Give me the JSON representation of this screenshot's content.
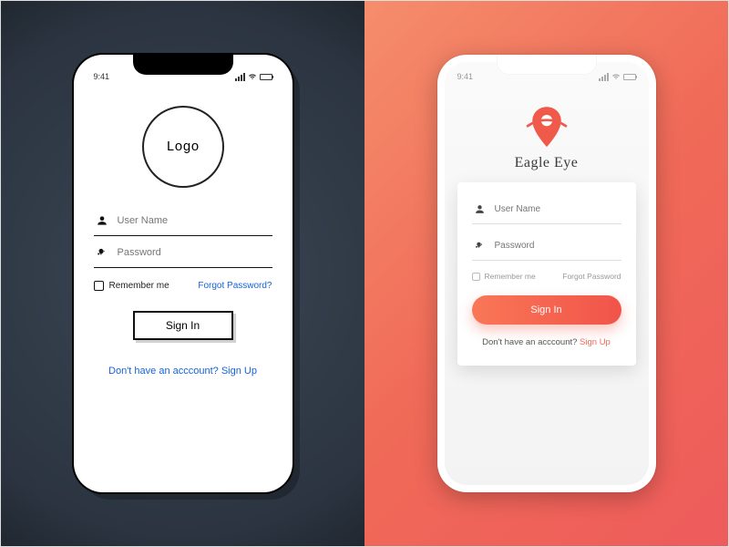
{
  "status": {
    "time": "9:41"
  },
  "left": {
    "logo_label": "Logo",
    "username_placeholder": "User Name",
    "password_placeholder": "Password",
    "remember_label": "Remember me",
    "forgot_label": "Forgot Password?",
    "signin_label": "Sign In",
    "signup_prompt": "Don't have an acccount? Sign Up"
  },
  "right": {
    "brand_name": "Eagle Eye",
    "username_placeholder": "User Name",
    "password_placeholder": "Password",
    "remember_label": "Remember me",
    "forgot_label": "Forgot Password",
    "signin_label": "Sign In",
    "signup_prompt": "Don't have an acccount? ",
    "signup_link": "Sign Up"
  },
  "colors": {
    "accent": "#f06a58",
    "link_blue": "#1763d6"
  }
}
